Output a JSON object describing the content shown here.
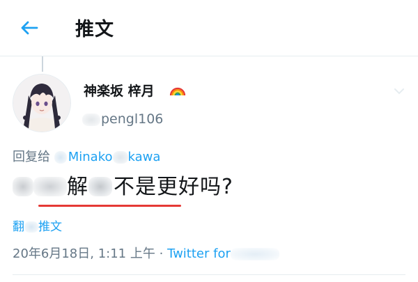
{
  "header": {
    "back_icon": "arrow-left-icon",
    "title": "推文"
  },
  "tweet": {
    "author": {
      "display_name": "神楽坂 梓月",
      "name_emoji_icon": "rainbow-icon",
      "handle_suffix": "pengl106"
    },
    "reply_to": {
      "prefix": "回复给",
      "mention_start": "Minako",
      "mention_end": "kawa"
    },
    "text_visible_start": "解",
    "text_visible_end": "不是更好吗?",
    "translate_start": "翻",
    "translate_end": "推文",
    "timestamp": "20年6月18日, 1:11 上午",
    "separator": "·",
    "client": "Twitter for"
  },
  "colors": {
    "accent": "#1da1f2",
    "text": "#14171a",
    "muted": "#657786",
    "underline": "#e53935",
    "divider": "#e6ecf0"
  }
}
